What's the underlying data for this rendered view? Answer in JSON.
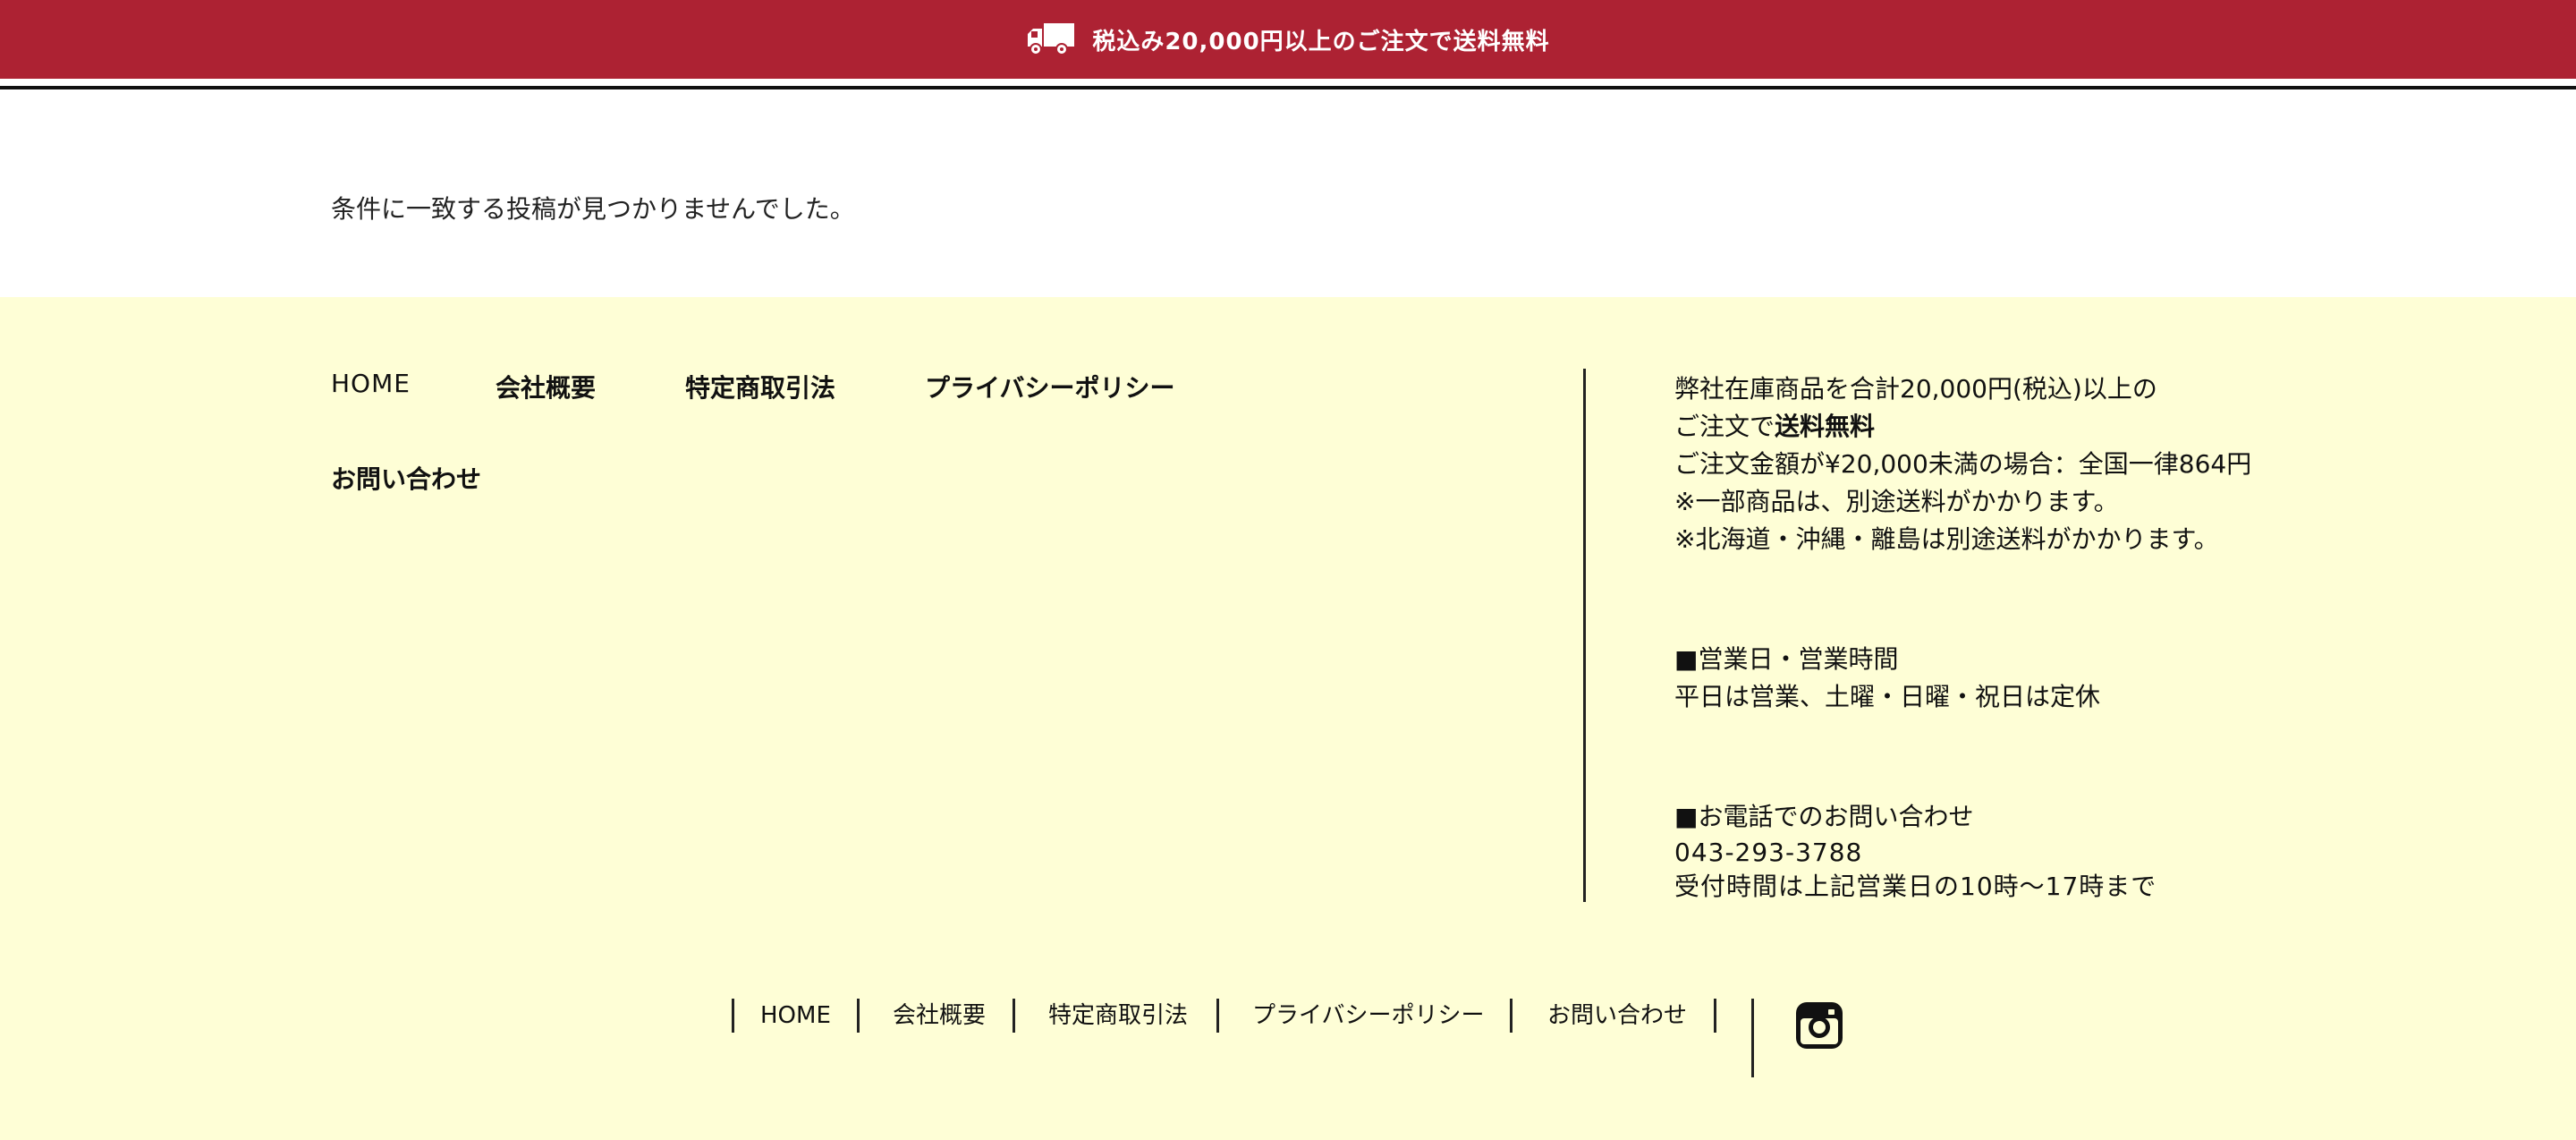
{
  "top_bar": {
    "icon": "truck-icon",
    "text": "税込み20,000円以上のご注文で送料無料",
    "bg_color": "#ad2233"
  },
  "main": {
    "no_posts_message": "条件に一致する投稿が見つかりませんでした。"
  },
  "footer": {
    "bg_color": "#fefed6",
    "nav": [
      {
        "label": "HOME"
      },
      {
        "label": "会社概要"
      },
      {
        "label": "特定商取引法"
      },
      {
        "label": "プライバシーポリシー"
      },
      {
        "label": "お問い合わせ"
      }
    ],
    "shipping": {
      "line1": "弊社在庫商品を合計20,000円(税込)以上の",
      "line2_prefix": "ご注文で",
      "line2_strong": "送料無料",
      "line3": "ご注文金額が¥20,000未満の場合：全国一律864円",
      "line4": "※一部商品は、別途送料がかかります。",
      "line5": "※北海道・沖縄・離島は別途送料がかかります。"
    },
    "business_hours": {
      "heading": "■営業日・営業時間",
      "text": "平日は営業、土曜・日曜・祝日は定休"
    },
    "phone": {
      "heading": "■お電話でのお問い合わせ",
      "number": "043-293-3788",
      "hours": "受付時間は上記営業日の10時〜17時まで"
    }
  },
  "bottom_nav": [
    {
      "label": "HOME"
    },
    {
      "label": "会社概要"
    },
    {
      "label": "特定商取引法"
    },
    {
      "label": "プライバシーポリシー"
    },
    {
      "label": "お問い合わせ"
    }
  ],
  "social": {
    "icon": "instagram-icon"
  }
}
